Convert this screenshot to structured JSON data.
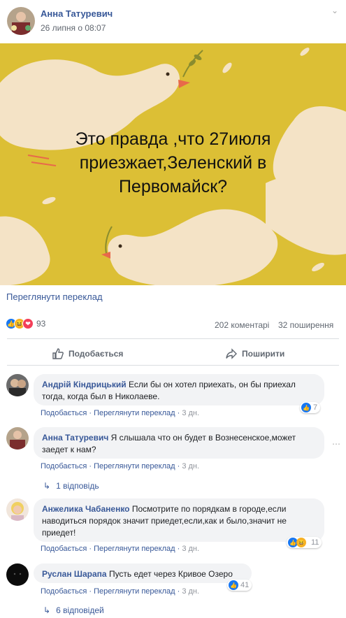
{
  "post": {
    "author": "Анна Татуревич",
    "time": "26 липня о 08:07",
    "image_text": "Это правда ,что 27июля приезжает,Зеленский в Первомайск?",
    "translate": "Переглянути переклад",
    "reactions_count": "93",
    "comments_count": "202 коментарі",
    "shares_count": "32 поширення",
    "like_label": "Подобається",
    "share_label": "Поширити"
  },
  "comments": [
    {
      "author": "Андрій Кіндрицький",
      "text": "Если бы он хотел приехать, он бы приехал тогда, когда был в Николаеве.",
      "like": "Подобається",
      "translate": "Переглянути переклад",
      "time": "3 дн.",
      "reactions": "7"
    },
    {
      "author": "Анна Татуревич",
      "text": "Я слышала что он будет в Вознесенское,может заедет к нам?",
      "like": "Подобається",
      "translate": "Переглянути переклад",
      "time": "3 дн.",
      "replies": "1 відповідь"
    },
    {
      "author": "Анжелика Чабаненко",
      "text": "Посмотрите по порядкам в городе,если наводиться порядок значит приедет,если,как и было,значит не приедет!",
      "like": "Подобається",
      "translate": "Переглянути переклад",
      "time": "3 дн.",
      "reactions": "11"
    },
    {
      "author": "Руслан Шарапа",
      "text": "Пусть едет через Кривое Озеро",
      "like": "Подобається",
      "translate": "Переглянути переклад",
      "time": "3 дн.",
      "reactions": "41",
      "replies": "6 відповідей"
    }
  ],
  "colors": {
    "link": "#385898",
    "like_blue": "#1877f2",
    "love_red": "#f33e58",
    "haha_yellow": "#f7b125",
    "image_bg": "#dcbf35"
  }
}
